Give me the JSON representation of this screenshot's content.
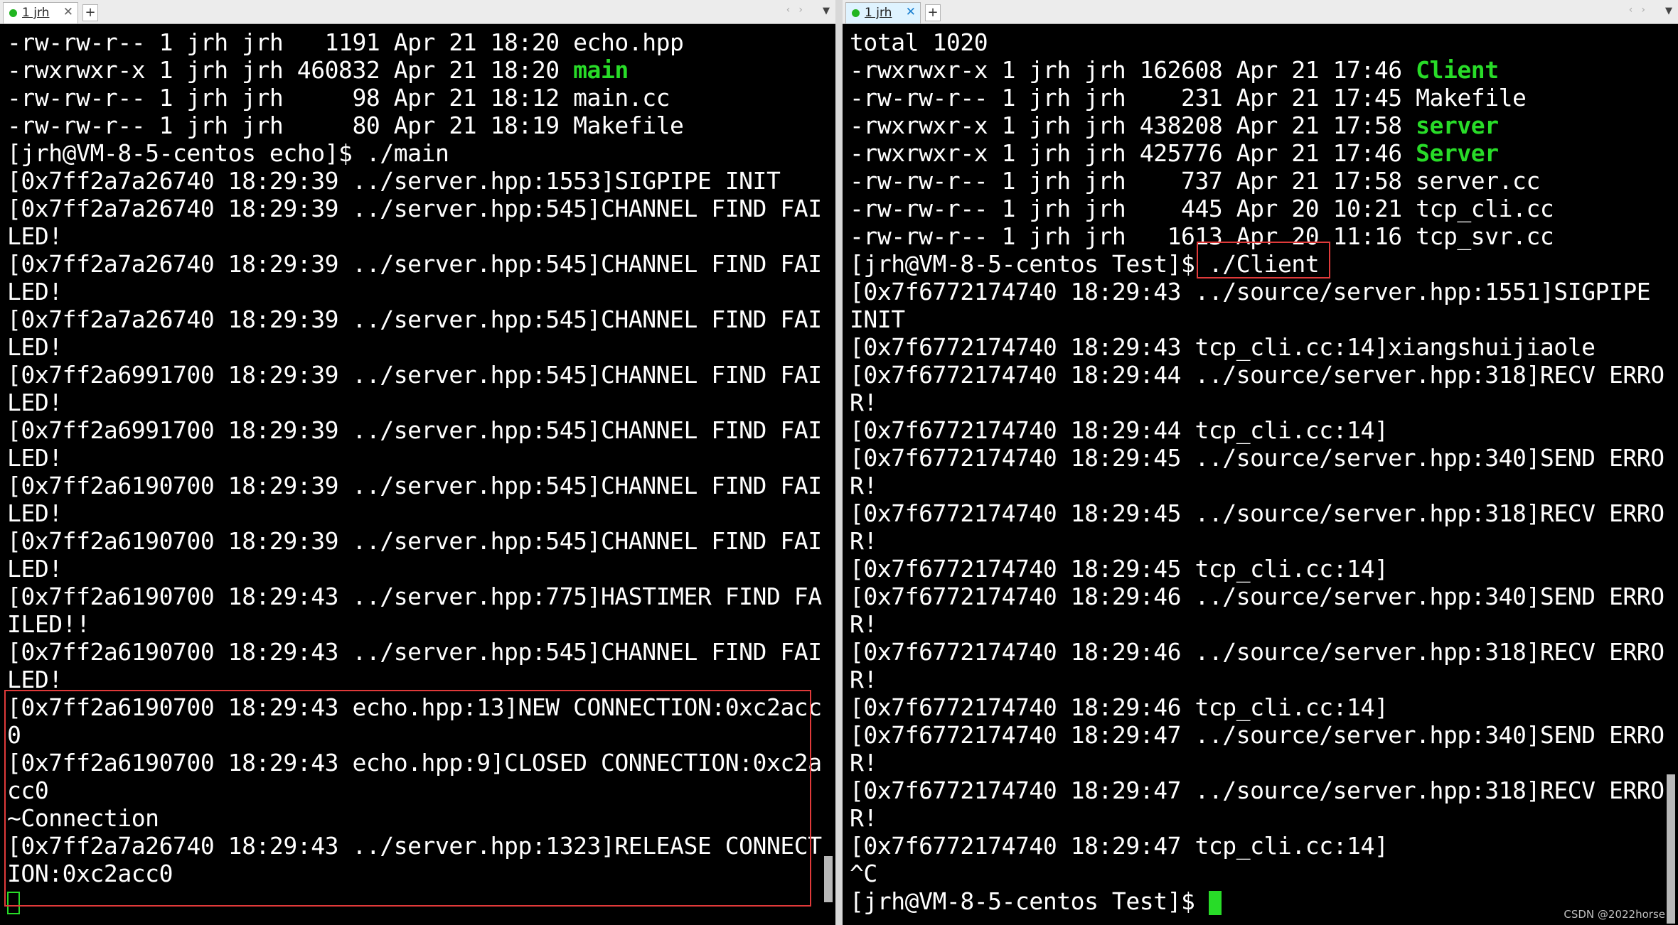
{
  "left_pane": {
    "tab_label": "1 jrh",
    "lines": [
      "-rw-rw-r-- 1 jrh jrh   1191 Apr 21 18:20 echo.hpp",
      "-rwxrwxr-x 1 jrh jrh 460832 Apr 21 18:20 ",
      "-rw-rw-r-- 1 jrh jrh     98 Apr 21 18:12 main.cc",
      "-rw-rw-r-- 1 jrh jrh     80 Apr 21 18:19 Makefile",
      "[jrh@VM-8-5-centos echo]$ ./main",
      "[0x7ff2a7a26740 18:29:39 ../server.hpp:1553]SIGPIPE INIT",
      "[0x7ff2a7a26740 18:29:39 ../server.hpp:545]CHANNEL FIND FAI",
      "LED!",
      "[0x7ff2a7a26740 18:29:39 ../server.hpp:545]CHANNEL FIND FAI",
      "LED!",
      "[0x7ff2a7a26740 18:29:39 ../server.hpp:545]CHANNEL FIND FAI",
      "LED!",
      "[0x7ff2a6991700 18:29:39 ../server.hpp:545]CHANNEL FIND FAI",
      "LED!",
      "[0x7ff2a6991700 18:29:39 ../server.hpp:545]CHANNEL FIND FAI",
      "LED!",
      "[0x7ff2a6190700 18:29:39 ../server.hpp:545]CHANNEL FIND FAI",
      "LED!",
      "[0x7ff2a6190700 18:29:39 ../server.hpp:545]CHANNEL FIND FAI",
      "LED!",
      "[0x7ff2a6190700 18:29:43 ../server.hpp:775]HASTIMER FIND FA",
      "ILED!!",
      "[0x7ff2a6190700 18:29:43 ../server.hpp:545]CHANNEL FIND FAI",
      "LED!",
      "[0x7ff2a6190700 18:29:43 echo.hpp:13]NEW CONNECTION:0xc2acc",
      "0",
      "[0x7ff2a6190700 18:29:43 echo.hpp:9]CLOSED CONNECTION:0xc2a",
      "cc0",
      "~Connection",
      "[0x7ff2a7a26740 18:29:43 ../server.hpp:1323]RELEASE CONNECT",
      "ION:0xc2acc0"
    ],
    "exec_name": "main"
  },
  "right_pane": {
    "tab_label": "1 jrh",
    "lines": [
      "total 1020",
      "-rwxrwxr-x 1 jrh jrh 162608 Apr 21 17:46 ",
      "-rw-rw-r-- 1 jrh jrh    231 Apr 21 17:45 Makefile",
      "-rwxrwxr-x 1 jrh jrh 438208 Apr 21 17:58 ",
      "-rwxrwxr-x 1 jrh jrh 425776 Apr 21 17:46 ",
      "-rw-rw-r-- 1 jrh jrh    737 Apr 21 17:58 server.cc",
      "-rw-rw-r-- 1 jrh jrh    445 Apr 20 10:21 tcp_cli.cc",
      "-rw-rw-r-- 1 jrh jrh   1613 Apr 20 11:16 tcp_svr.cc",
      "[jrh@VM-8-5-centos Test]$ ./Client",
      "[0x7f6772174740 18:29:43 ../source/server.hpp:1551]SIGPIPE",
      "INIT",
      "[0x7f6772174740 18:29:43 tcp_cli.cc:14]xiangshuijiaole",
      "[0x7f6772174740 18:29:44 ../source/server.hpp:318]RECV ERRO",
      "R!",
      "[0x7f6772174740 18:29:44 tcp_cli.cc:14]",
      "[0x7f6772174740 18:29:45 ../source/server.hpp:340]SEND ERRO",
      "R!",
      "[0x7f6772174740 18:29:45 ../source/server.hpp:318]RECV ERRO",
      "R!",
      "[0x7f6772174740 18:29:45 tcp_cli.cc:14]",
      "[0x7f6772174740 18:29:46 ../source/server.hpp:340]SEND ERRO",
      "R!",
      "[0x7f6772174740 18:29:46 ../source/server.hpp:318]RECV ERRO",
      "R!",
      "[0x7f6772174740 18:29:46 tcp_cli.cc:14]",
      "[0x7f6772174740 18:29:47 ../source/server.hpp:340]SEND ERRO",
      "R!",
      "[0x7f6772174740 18:29:47 ../source/server.hpp:318]RECV ERRO",
      "R!",
      "[0x7f6772174740 18:29:47 tcp_cli.cc:14]",
      "^C",
      "[jrh@VM-8-5-centos Test]$ "
    ],
    "exec_names": [
      "Client",
      "server",
      "Server"
    ]
  },
  "watermark": "CSDN @2022horse",
  "colors": {
    "terminal_bg": "#000000",
    "text": "#ffffff",
    "executable": "#28dc28",
    "highlight": "#e03a3a"
  },
  "icons": {
    "tab_status": "green-dot-icon",
    "close": "close-icon",
    "new_tab": "plus-icon",
    "cursor": "block-cursor-icon"
  }
}
